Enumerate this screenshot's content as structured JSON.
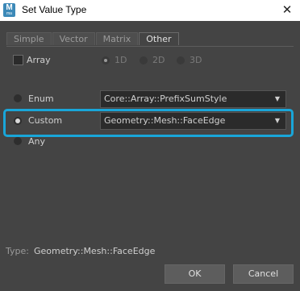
{
  "window": {
    "title": "Set Value Type",
    "app_icon_letter": "M",
    "app_icon_sub": "ma",
    "close_glyph": "✕"
  },
  "tabs": [
    {
      "label": "Simple",
      "active": false
    },
    {
      "label": "Vector",
      "active": false
    },
    {
      "label": "Matrix",
      "active": false
    },
    {
      "label": "Other",
      "active": true
    }
  ],
  "array": {
    "label": "Array",
    "checked": false,
    "dims": [
      "1D",
      "2D",
      "3D"
    ],
    "selected_dim": "1D"
  },
  "options": {
    "enum": {
      "label": "Enum",
      "value": "Core::Array::PrefixSumStyle"
    },
    "custom": {
      "label": "Custom",
      "value": "Geometry::Mesh::FaceEdge",
      "selected": true
    },
    "any": {
      "label": "Any"
    }
  },
  "type": {
    "label": "Type:",
    "value": "Geometry::Mesh::FaceEdge"
  },
  "buttons": {
    "ok": "OK",
    "cancel": "Cancel"
  },
  "colors": {
    "accent_highlight": "#19a6d9",
    "background": "#444444"
  }
}
